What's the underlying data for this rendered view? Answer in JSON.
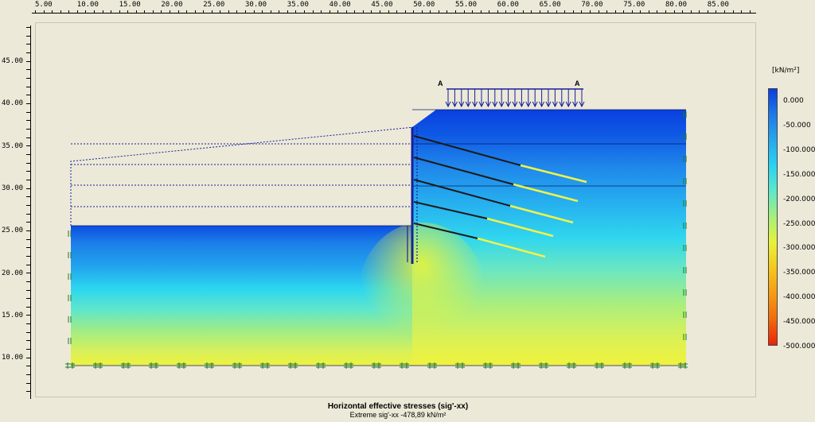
{
  "axes": {
    "x_ticks": [
      "5.00",
      "10.00",
      "15.00",
      "20.00",
      "25.00",
      "30.00",
      "35.00",
      "40.00",
      "45.00",
      "50.00",
      "55.00",
      "60.00",
      "65.00",
      "70.00",
      "75.00",
      "80.00",
      "85.00"
    ],
    "y_ticks": [
      "45.00",
      "40.00",
      "35.00",
      "30.00",
      "25.00",
      "20.00",
      "15.00",
      "10.00"
    ]
  },
  "load_labels": {
    "left": "A",
    "right": "A"
  },
  "legend": {
    "unit": "[kN/m²]",
    "labels": [
      "0.000",
      "-50.000",
      "-100.000",
      "-150.000",
      "-200.000",
      "-250.000",
      "-300.000",
      "-350.000",
      "-400.000",
      "-450.000",
      "-500.000"
    ],
    "colors": [
      "#0a3ee0",
      "#1e7ae6",
      "#25a8ee",
      "#2ad3f0",
      "#5ee8c8",
      "#a6ef7a",
      "#e9f23a",
      "#f5c71b",
      "#f59c12",
      "#f26a0c",
      "#ea2308"
    ]
  },
  "caption": {
    "title": "Horizontal effective stresses (sig'-xx)",
    "subtitle": "Extreme sig'-xx -478,89 kN/m²"
  },
  "colors": {
    "background": "#ece9d8",
    "wall": "#1a1f9c",
    "anchor_free": "#1a1a1a",
    "anchor_grout": "#f1f24a",
    "boundary": "#1d7a2c"
  }
}
